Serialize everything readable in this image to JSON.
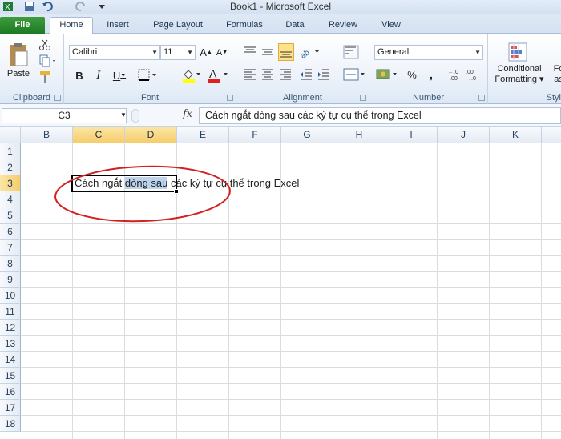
{
  "window": {
    "title": "Book1 - Microsoft Excel"
  },
  "tabs": [
    "File",
    "Home",
    "Insert",
    "Page Layout",
    "Formulas",
    "Data",
    "Review",
    "View"
  ],
  "ribbon": {
    "clipboard": {
      "label": "Clipboard",
      "paste": "Paste"
    },
    "font": {
      "label": "Font",
      "font_name": "Calibri",
      "font_size": "11"
    },
    "alignment": {
      "label": "Alignment"
    },
    "number": {
      "label": "Number",
      "format": "General"
    },
    "styles": {
      "conditional_line1": "Conditional",
      "conditional_line2": "Formatting",
      "format_as_line1": "Fo",
      "format_as_line2": "as",
      "label": "Styl"
    }
  },
  "formula_bar": {
    "name_box": "C3",
    "fx": "fx",
    "content": "Cách ngắt dòng sau các ký tự cụ thể trong Excel"
  },
  "grid": {
    "columns": [
      "B",
      "C",
      "D",
      "E",
      "F",
      "G",
      "H",
      "I",
      "J",
      "K"
    ],
    "selected_columns": [
      "C",
      "D"
    ],
    "rows": [
      "1",
      "2",
      "3",
      "4",
      "5",
      "6",
      "7",
      "8",
      "9",
      "10",
      "11",
      "12",
      "13",
      "14",
      "15",
      "16",
      "17",
      "18"
    ],
    "selected_row": "3",
    "cell_text_before": "Cách ngắt ",
    "cell_text_selected": "dòng sau",
    "cell_text_after": " các ký tự cụ thể trong Excel"
  },
  "colors": {
    "annotation_ellipse": "#d42020",
    "file_tab": "#2a8a2f",
    "selection": "#bcd3ee"
  }
}
